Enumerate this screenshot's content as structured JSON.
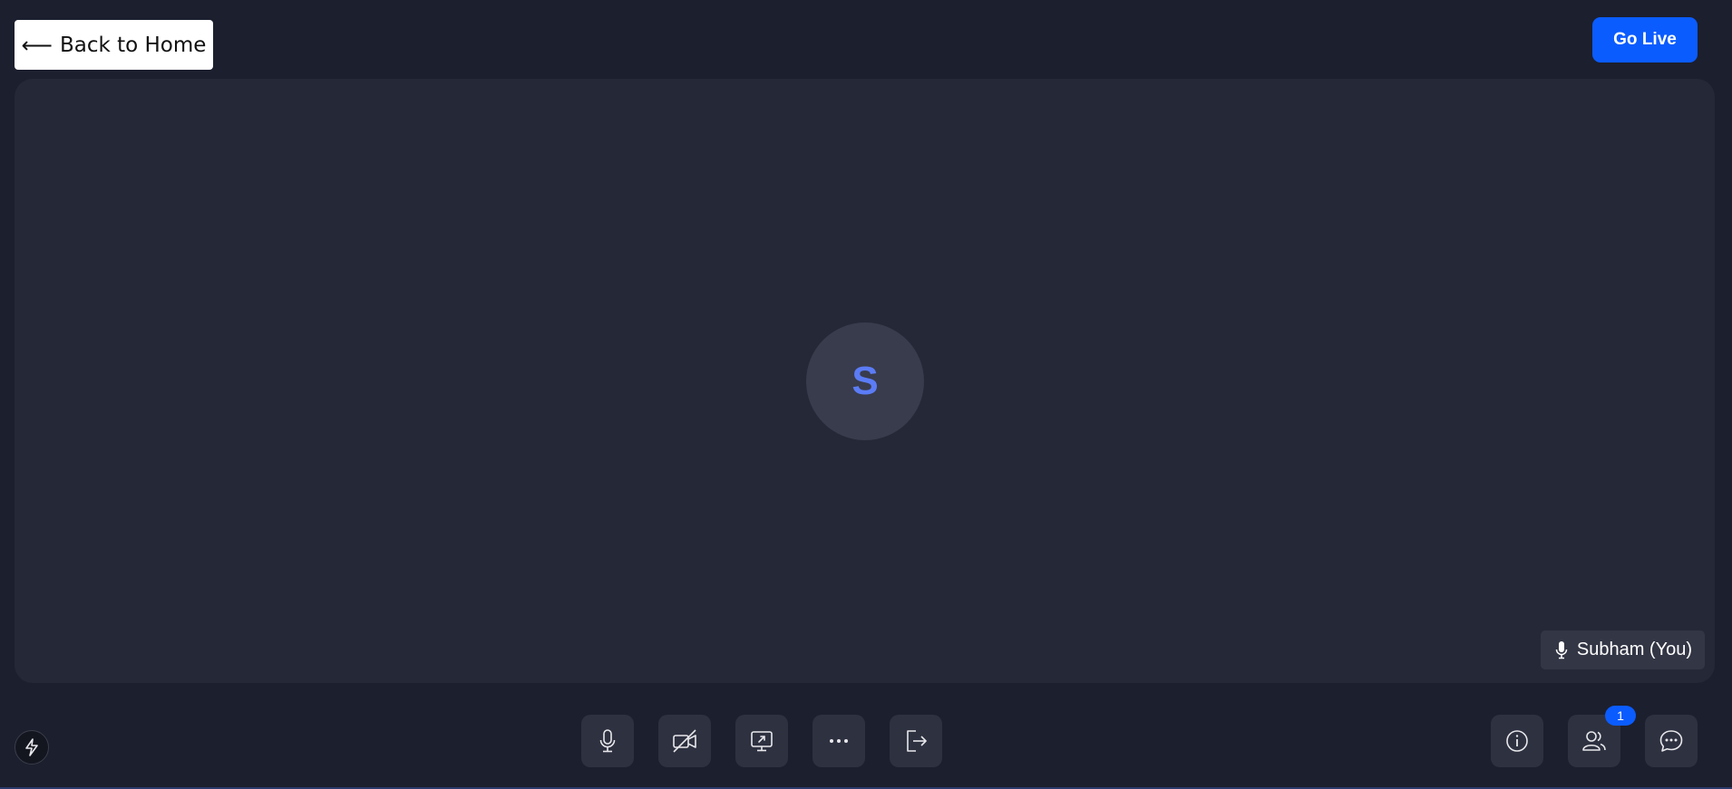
{
  "header": {
    "back_label": "Back to Home",
    "back_arrow": "⟵",
    "go_live_label": "Go Live"
  },
  "stage": {
    "avatar_initial": "S",
    "participant_name": "Subham (You)",
    "participant_mic_icon": "mic-icon"
  },
  "controls": {
    "center": [
      "mic-icon",
      "camera-off-icon",
      "screen-share-icon",
      "more-icon",
      "leave-icon"
    ],
    "right": [
      "info-icon",
      "participants-icon",
      "chat-icon"
    ],
    "participants_count": "1"
  },
  "colors": {
    "background": "#1c1f2e",
    "stage": "#252837",
    "accent": "#0b5cff",
    "avatar_text": "#5b7cf6"
  }
}
